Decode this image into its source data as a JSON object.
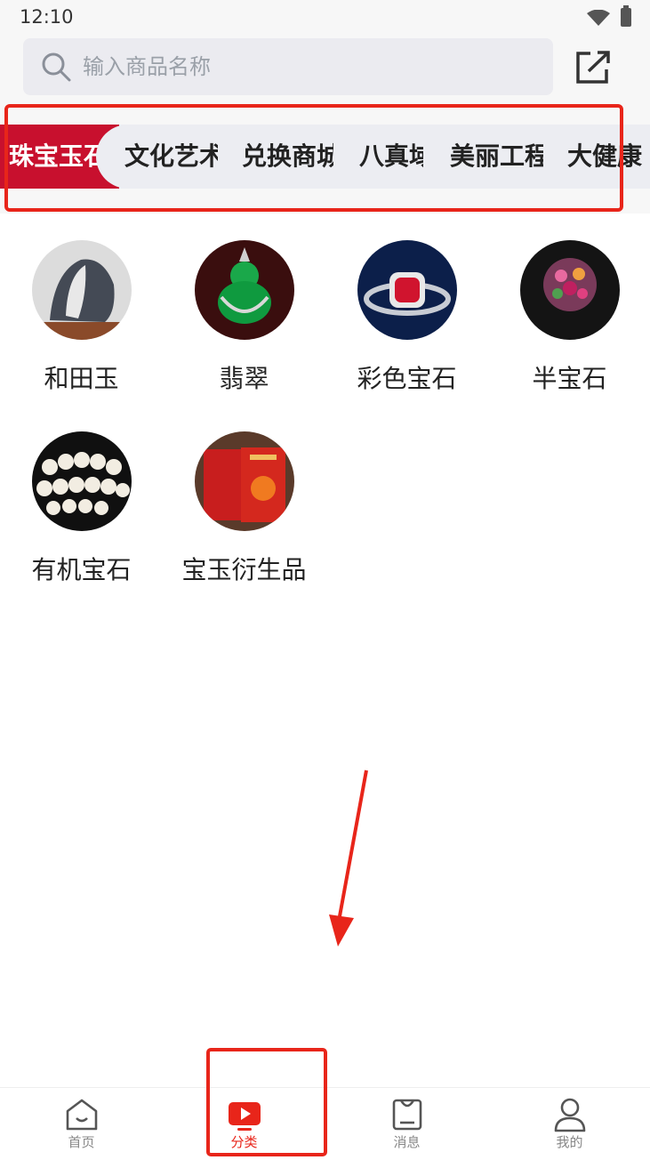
{
  "status": {
    "time": "12:10"
  },
  "search": {
    "placeholder": "输入商品名称"
  },
  "tabs": [
    {
      "label": "珠宝玉石",
      "active": true
    },
    {
      "label": "文化艺术"
    },
    {
      "label": "兑换商城"
    },
    {
      "label": "八真域"
    },
    {
      "label": "美丽工程"
    },
    {
      "label": "大健康"
    }
  ],
  "categories": [
    {
      "label": "和田玉",
      "icon": "hetian-jade-photo"
    },
    {
      "label": "翡翠",
      "icon": "jadeite-buddha-photo"
    },
    {
      "label": "彩色宝石",
      "icon": "ruby-ring-photo"
    },
    {
      "label": "半宝石",
      "icon": "gemstone-ring-photo"
    },
    {
      "label": "有机宝石",
      "icon": "pearl-necklace-photo"
    },
    {
      "label": "宝玉衍生品",
      "icon": "gift-box-photo"
    }
  ],
  "bottom_nav": [
    {
      "label": "首页",
      "icon": "home-icon"
    },
    {
      "label": "分类",
      "icon": "category-play-icon",
      "active": true
    },
    {
      "label": "消息",
      "icon": "message-bag-icon"
    },
    {
      "label": "我的",
      "icon": "profile-icon"
    }
  ],
  "colors": {
    "accent": "#c8102e",
    "annotation": "#e8251a",
    "background": "#f7f7f7"
  }
}
